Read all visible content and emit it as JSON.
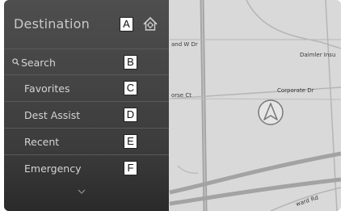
{
  "panel": {
    "title": "Destination",
    "title_callout": "A",
    "items": [
      {
        "label": "Search",
        "callout": "B",
        "icon": "search-icon"
      },
      {
        "label": "Favorites",
        "callout": "C"
      },
      {
        "label": "Dest Assist",
        "callout": "D"
      },
      {
        "label": "Recent",
        "callout": "E"
      },
      {
        "label": "Emergency",
        "callout": "F"
      }
    ],
    "home_icon": "home-icon",
    "scroll_icon": "chevron-down-icon"
  },
  "map": {
    "streets": [
      "and W Dr",
      "Daimler Insu",
      "orse Ct",
      "Corporate Dr",
      "ward Rd"
    ],
    "position_icon": "navigation-arrow-icon"
  },
  "colors": {
    "panel": "#454545",
    "map_background": "#d8d8d8",
    "road": "#9a9a9a",
    "text": "#d4d4d4"
  }
}
